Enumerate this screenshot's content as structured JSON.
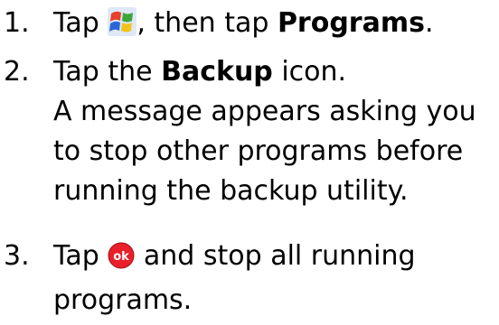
{
  "steps": [
    {
      "number": "1.",
      "part1": "Tap",
      "icon": "windows-start-icon",
      "part2": ", then tap",
      "bold": "Programs",
      "part3": "."
    },
    {
      "number": "2.",
      "part1": "Tap the",
      "bold": "Backup",
      "part2": "icon.",
      "lines": [
        "A message appears asking you",
        "to stop other programs before",
        "running the backup utility."
      ]
    },
    {
      "number": "3.",
      "part1": "Tap",
      "icon": "ok-icon",
      "part2": "and stop all running",
      "line2": "programs."
    }
  ],
  "colors": {
    "text": "#000000",
    "ok_icon": "#e8202a",
    "windows_flag": [
      "#e8402a",
      "#3fa53a",
      "#2a66d8",
      "#f2c31e"
    ]
  }
}
